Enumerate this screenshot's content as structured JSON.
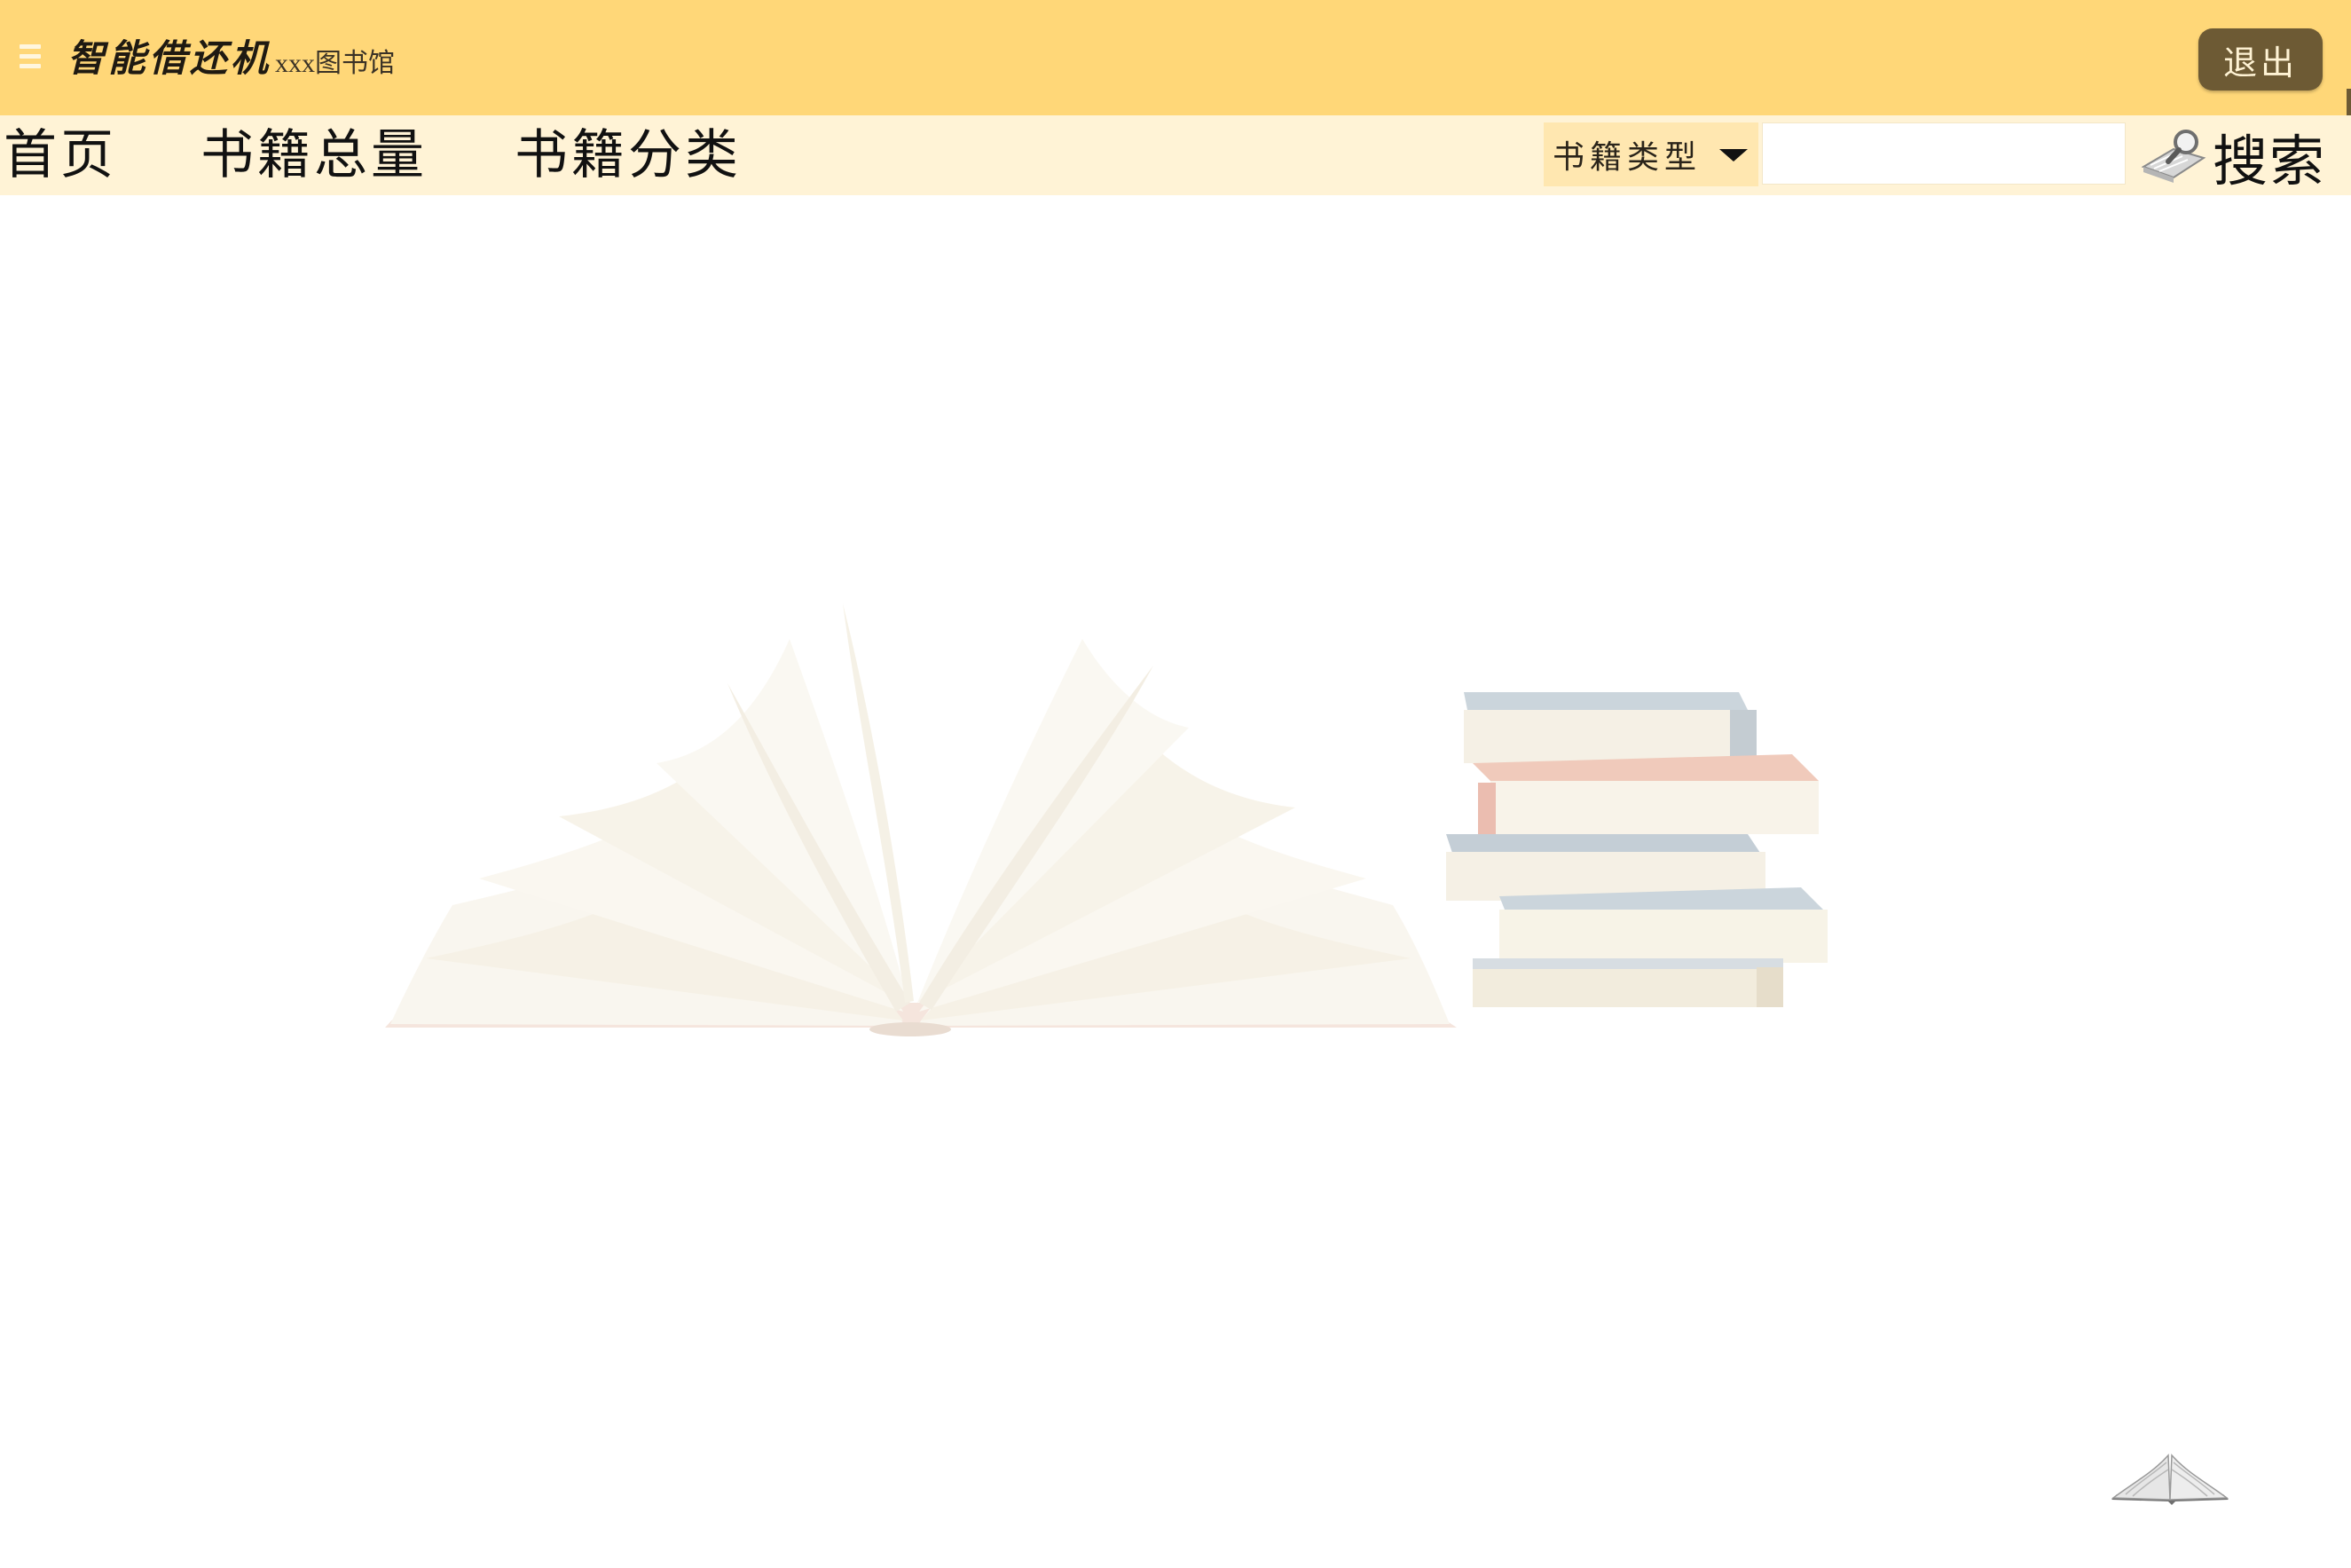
{
  "header": {
    "brand_title": "智能借还机",
    "brand_subtitle": "xxx图书馆",
    "logout_label": "退出",
    "background_color": "#ffd778",
    "menu_icon": "hamburger-menu-icon"
  },
  "nav": {
    "items": [
      {
        "label": "首页"
      },
      {
        "label": "书籍总量"
      },
      {
        "label": "书籍分类"
      }
    ],
    "background_color": "#fff3d6"
  },
  "search": {
    "type_select_value": "书籍类型",
    "input_value": "",
    "input_placeholder": "",
    "button_label": "搜索",
    "button_icon": "search-magnifier-icon"
  },
  "hero": {
    "illustration": "open-book-and-book-stack-illustration"
  },
  "footer": {
    "corner_icon": "open-book-icon"
  }
}
